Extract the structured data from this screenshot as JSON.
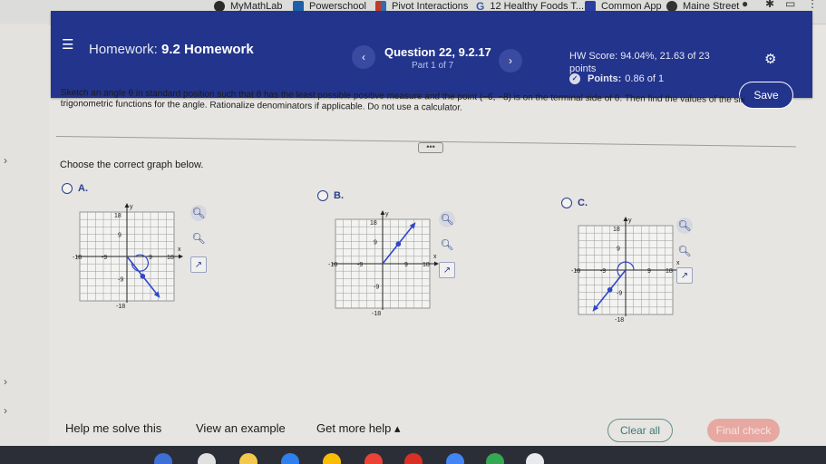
{
  "browser": {
    "bookmarks": [
      {
        "label": "MyMathLab",
        "icon": "mymathlab-icon"
      },
      {
        "label": "Powerschool",
        "icon": "powerschool-icon"
      },
      {
        "label": "Pivot Interactions",
        "icon": "pivot-icon"
      },
      {
        "label": "12 Healthy Foods T...",
        "icon": "google-icon"
      },
      {
        "label": "Common App",
        "icon": "common-app-icon"
      },
      {
        "label": "Maine Street",
        "icon": "maine-street-icon"
      }
    ]
  },
  "header": {
    "homework_prefix": "Homework:",
    "homework_name": "9.2 Homework",
    "prev_glyph": "‹",
    "next_glyph": "›",
    "question_title": "Question 22, 9.2.17",
    "part_label": "Part 1 of 7",
    "hw_score": "HW Score: 94.04%, 21.63 of 23 points",
    "points_label": "Points:",
    "points_value": "0.86 of 1",
    "save_label": "Save",
    "accent_color": "#23348c"
  },
  "question": {
    "text": "Sketch an angle θ in standard position such that θ has the least possible positive measure and the point (−6, −8) is on the terminal side of θ. Then find the values of the six trigonometric functions for the angle. Rationalize denominators if applicable. Do not use a calculator.",
    "ellipsis": "•••",
    "prompt": "Choose the correct graph below."
  },
  "options": [
    {
      "letter": "A.",
      "selected": false
    },
    {
      "letter": "B.",
      "selected": false
    },
    {
      "letter": "C.",
      "selected": false
    }
  ],
  "graphs": [
    {
      "x_label": "x",
      "y_label": "y",
      "tick_labels": {
        "y_top": "18",
        "y_mid": "9",
        "x_left": "-18",
        "x_mid_left": "-9",
        "x_right": "18",
        "x_mid_right": "9",
        "y_neg_mid": "-9",
        "y_bottom": "-18"
      },
      "xlim": [
        -18,
        18
      ],
      "ylim": [
        -18,
        18
      ],
      "point": [
        6,
        -8
      ],
      "line_end": [
        12,
        -16
      ],
      "arc": "clockwise-from-positive-x"
    },
    {
      "x_label": "x",
      "y_label": "y",
      "tick_labels": {
        "y_top": "18",
        "y_mid": "9",
        "x_left": "-18",
        "x_mid_left": "-9",
        "x_right": "18",
        "x_mid_right": "9",
        "y_neg_mid": "-9",
        "y_bottom": "-18"
      },
      "xlim": [
        -18,
        18
      ],
      "ylim": [
        -18,
        18
      ],
      "point": [
        6,
        8
      ],
      "line_end": [
        12,
        16
      ],
      "arc": "none"
    },
    {
      "x_label": "x",
      "y_label": "y",
      "tick_labels": {
        "y_top": "18",
        "y_mid": "9",
        "x_left": "-18",
        "x_mid_left": "-9",
        "x_right": "18",
        "x_mid_right": "9",
        "y_neg_mid": "-9",
        "y_bottom": "-18"
      },
      "xlim": [
        -18,
        18
      ],
      "ylim": [
        -18,
        18
      ],
      "point": [
        -6,
        -8
      ],
      "line_end": [
        -12,
        -16
      ],
      "arc": "counterclockwise-from-positive-x"
    }
  ],
  "graph_tools": [
    "zoom-in-icon",
    "zoom-out-icon",
    "open-in-new-icon"
  ],
  "footer": {
    "help_label": "Help me solve this",
    "example_label": "View an example",
    "more_help_label": "Get more help ▴",
    "clear_label": "Clear all",
    "final_label": "Final check"
  }
}
